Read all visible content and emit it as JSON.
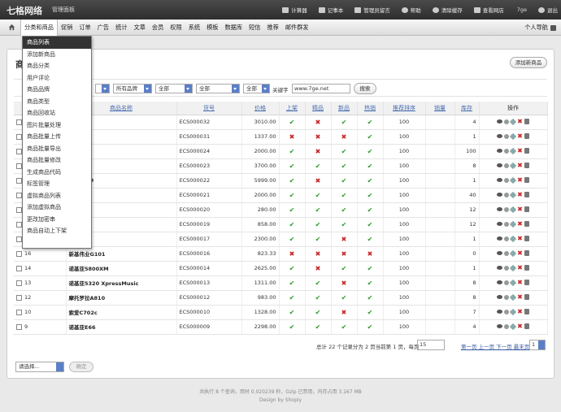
{
  "header": {
    "brand": "七格网络",
    "subtitle": "管理面板",
    "links": [
      {
        "label": "计算器",
        "icon": "calculator-icon"
      },
      {
        "label": "记事本",
        "icon": "notepad-icon"
      },
      {
        "label": "管理员留言",
        "icon": "message-icon"
      },
      {
        "label": "帮助",
        "icon": "help-icon"
      },
      {
        "label": "清除缓存",
        "icon": "refresh-icon"
      },
      {
        "label": "查看网店",
        "icon": "store-icon"
      }
    ],
    "username": "7ge",
    "logout": "退出"
  },
  "nav": {
    "items": [
      "分类和商品",
      "促销",
      "订单",
      "广告",
      "统计",
      "文章",
      "会员",
      "权限",
      "系统",
      "模板",
      "数据库",
      "短信",
      "推荐",
      "邮件群发"
    ],
    "right": "个人导航"
  },
  "menu": {
    "items": [
      "商品列表",
      "添加新商品",
      "商品分类",
      "用户评论",
      "商品品牌",
      "商品类型",
      "商品回收站",
      "图片批量处理",
      "商品批量上传",
      "商品批量导出",
      "商品批量修改",
      "生成商品代码",
      "标签管理",
      "虚拟商品列表",
      "添加虚拟商品",
      "更改加密串",
      "商品自动上下架"
    ]
  },
  "page": {
    "title": "商",
    "add_button": "添加新商品"
  },
  "filters": {
    "brand": "所有品牌",
    "s1": "全部",
    "s2": "全部",
    "s3": "全部",
    "keyword_label": "关键字",
    "keyword_value": "www.7ge.net",
    "search_button": "搜索"
  },
  "table": {
    "headers": [
      "编号",
      "商品名称",
      "货号",
      "价格",
      "上架",
      "精品",
      "新品",
      "热销",
      "推荐排序",
      "销量",
      "库存",
      "操作"
    ],
    "rows": [
      {
        "id": "",
        "name": "85",
        "sku": "ECS000032",
        "price": "3010.00",
        "flags": [
          1,
          0,
          1,
          1
        ],
        "sort": "100",
        "sales": "",
        "stock": "4",
        "red": true
      },
      {
        "id": "",
        "name": "E8",
        "sku": "ECS000031",
        "price": "1337.00",
        "flags": [
          0,
          0,
          0,
          1
        ],
        "sort": "100",
        "sales": "",
        "stock": "1",
        "red": false
      },
      {
        "id": "",
        "name": "",
        "sku": "ECS000024",
        "price": "2000.00",
        "flags": [
          1,
          0,
          1,
          1
        ],
        "sort": "100",
        "sales": "",
        "stock": "100",
        "red": false
      },
      {
        "id": "",
        "name": "96",
        "sku": "ECS000023",
        "price": "3700.00",
        "flags": [
          1,
          1,
          1,
          1
        ],
        "sort": "100",
        "sales": "",
        "stock": "8",
        "red": false
      },
      {
        "id": "",
        "name": "ouch HD",
        "sku": "ECS000022",
        "price": "5999.00",
        "flags": [
          1,
          0,
          1,
          1
        ],
        "sort": "100",
        "sales": "",
        "stock": "1",
        "red": false
      },
      {
        "id": "",
        "name": "9",
        "sku": "ECS000021",
        "price": "2000.00",
        "flags": [
          1,
          1,
          1,
          1
        ],
        "sort": "100",
        "sales": "",
        "stock": "40",
        "red": false
      },
      {
        "id": "",
        "name": "01",
        "sku": "ECS000020",
        "price": "280.00",
        "flags": [
          1,
          1,
          1,
          1
        ],
        "sort": "100",
        "sales": "",
        "stock": "12",
        "red": false
      },
      {
        "id": "",
        "name": "4F258",
        "sku": "ECS000019",
        "price": "858.00",
        "flags": [
          1,
          1,
          1,
          1
        ],
        "sort": "100",
        "sales": "",
        "stock": "12",
        "red": false
      },
      {
        "id": "",
        "name": "",
        "sku": "ECS000017",
        "price": "2300.00",
        "flags": [
          1,
          1,
          0,
          1
        ],
        "sort": "100",
        "sales": "",
        "stock": "1",
        "red": false
      },
      {
        "id": "16",
        "name": "新基伟业G101",
        "sku": "ECS000016",
        "price": "823.33",
        "flags": [
          0,
          0,
          0,
          0
        ],
        "sort": "100",
        "sales": "",
        "stock": "0",
        "red": false
      },
      {
        "id": "14",
        "name": "诺基亚5800XM",
        "sku": "ECS000014",
        "price": "2625.00",
        "flags": [
          1,
          0,
          1,
          1
        ],
        "sort": "100",
        "sales": "",
        "stock": "1",
        "red": false
      },
      {
        "id": "13",
        "name": "诺基亚5320 XpressMusic",
        "sku": "ECS000013",
        "price": "1311.00",
        "flags": [
          1,
          1,
          0,
          1
        ],
        "sort": "100",
        "sales": "",
        "stock": "8",
        "red": false
      },
      {
        "id": "12",
        "name": "摩托罗拉A810",
        "sku": "ECS000012",
        "price": "983.00",
        "flags": [
          1,
          1,
          1,
          1
        ],
        "sort": "100",
        "sales": "",
        "stock": "8",
        "red": false
      },
      {
        "id": "10",
        "name": "索爱C702c",
        "sku": "ECS000010",
        "price": "1328.00",
        "flags": [
          1,
          1,
          0,
          1
        ],
        "sort": "100",
        "sales": "",
        "stock": "7",
        "red": false
      },
      {
        "id": "9",
        "name": "诺基亚E66",
        "sku": "ECS000009",
        "price": "2298.00",
        "flags": [
          1,
          1,
          1,
          1
        ],
        "sort": "100",
        "sales": "",
        "stock": "4",
        "red": false
      }
    ]
  },
  "pager": {
    "summary": "总计 22 个记录分为 2 页当前第 1 页，每页",
    "per_page": "15",
    "links": "第一页 上一页 下一页 最末页",
    "page": "1"
  },
  "batch": {
    "select": "请选择...",
    "confirm": "确定"
  },
  "footer": {
    "line1": "共执行 8 个查询，用时 0.020239 秒，Gzip 已禁用，内存占用 3.167 MB",
    "line2": "Design by Shopiy"
  }
}
